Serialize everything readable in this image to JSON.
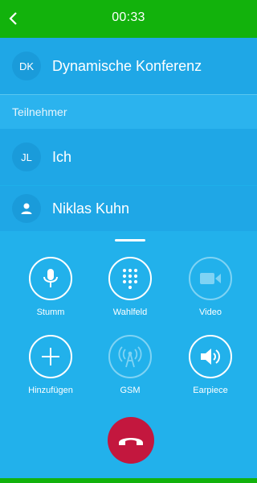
{
  "status_bar": {
    "timer": "00:33"
  },
  "conference": {
    "avatar_initials": "DK",
    "name": "Dynamische Konferenz"
  },
  "participants_section": {
    "title": "Teilnehmer"
  },
  "participants": [
    {
      "avatar_initials": "JL",
      "name": "Ich"
    },
    {
      "avatar_icon": "person-icon",
      "name": "Niklas Kuhn"
    }
  ],
  "controls": [
    {
      "label": "Stumm",
      "icon": "microphone-icon",
      "enabled": true
    },
    {
      "label": "Wahlfeld",
      "icon": "dialpad-icon",
      "enabled": true
    },
    {
      "label": "Video",
      "icon": "video-camera-icon",
      "enabled": false
    },
    {
      "label": "Hinzufügen",
      "icon": "plus-icon",
      "enabled": true
    },
    {
      "label": "GSM",
      "icon": "antenna-icon",
      "enabled": false
    },
    {
      "label": "Earpiece",
      "icon": "speaker-icon",
      "enabled": true
    }
  ],
  "colors": {
    "status_bar": "#12b20c",
    "background": "#1eb0ea",
    "hangup": "#c3173e"
  }
}
